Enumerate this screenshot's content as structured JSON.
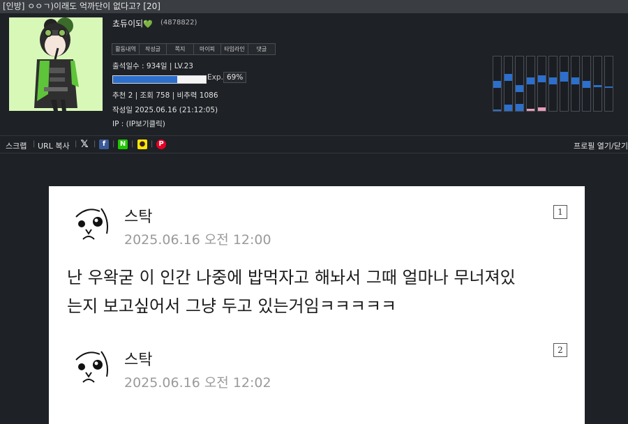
{
  "title": "[인방] ㅇㅇㄱ)이래도 억까단이 없다고? [20]",
  "profile": {
    "nickname": "쵸듀이되",
    "heart": "💚",
    "user_id": "(4878822)",
    "tabs": [
      "활동내역",
      "작성글",
      "쪽지",
      "마이피",
      "타임라인",
      "댓글"
    ],
    "attendance": "출석일수 : 934일 | LV.23",
    "exp_label": "Exp.",
    "exp_percent_text": "69%",
    "exp_fraction": 0.69,
    "stats": "추천 2 | 조회 758 | 비추력 1086",
    "written": "작성일 2025.06.16 (21:12:05)",
    "ip": "IP : (IP보기클릭)",
    "activity_levels": [
      0.55,
      0.68,
      0.48,
      0.62,
      0.66,
      0.62,
      0.72,
      0.62,
      0.55,
      0.48,
      0.45
    ]
  },
  "share": {
    "scrap": "스크랩",
    "copy_url": "URL 복사",
    "open_profile": "프로필 열기/닫기"
  },
  "posts": [
    {
      "number": "1",
      "name": "스탁",
      "date": "2025.06.16 오전 12:00",
      "lines": [
        "난 우왁굳 이 인간 나중에 밥먹자고 해놔서 그때 얼마나 무너져있",
        "는지 보고싶어서 그냥 두고 있는거임ㅋㅋㅋㅋㅋ"
      ]
    },
    {
      "number": "2",
      "name": "스탁",
      "date": "2025.06.16 오전 12:02",
      "lines": []
    }
  ]
}
